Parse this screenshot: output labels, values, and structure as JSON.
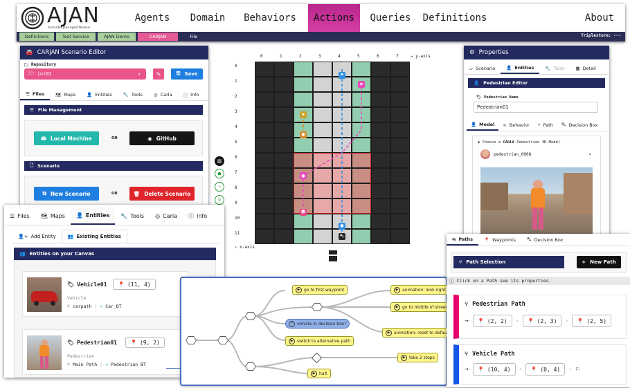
{
  "app": {
    "logo_text": "AJAN",
    "logo_subtitle": "Accessible Java Agent Nucleus",
    "nav": [
      "Agents",
      "Domain",
      "Behaviors",
      "Actions",
      "Queries",
      "Definitions"
    ],
    "nav_about": "About",
    "subnav": [
      "Definitions",
      "Test Service",
      "AJAN Demo",
      "CARJAN",
      "File"
    ],
    "triplestore": "Triplestore: ---",
    "colors": {
      "nav_bg": "#ffffff",
      "active_nav": "#c8359c",
      "subnav_bg": "#2a2d55",
      "navy": "#232a60",
      "pink": "#e9558a"
    }
  },
  "editor": {
    "title": "CARJAN Scenario Editor",
    "repo_label": "Repository",
    "repo_value": "int01",
    "save_label": "Save",
    "tabs": [
      "Files",
      "Maps",
      "Entities",
      "Tools",
      "Carla",
      "Info"
    ],
    "file_management": "File Management",
    "local_machine": "Local Machine",
    "or1": "OR",
    "github": "GitHub",
    "scenario_header": "Scenario",
    "new_scenario": "New Scenario",
    "or2": "OR",
    "delete_scenario": "Delete Scenario"
  },
  "grid": {
    "col_labels": [
      "0",
      "1",
      "2",
      "3",
      "4",
      "5",
      "6",
      "7"
    ],
    "row_labels": [
      "0",
      "1",
      "2",
      "3",
      "4",
      "5",
      "6",
      "7",
      "8",
      "9",
      "10",
      "11"
    ],
    "y_axis": "→ y-axis",
    "x_axis": "↓ x-axis",
    "col_types": [
      "dark",
      "dark",
      "green",
      "grey",
      "grey",
      "green",
      "dark",
      "dark"
    ],
    "decision_box": {
      "rows": [
        6,
        9
      ],
      "cols": [
        2,
        5
      ]
    }
  },
  "properties": {
    "title": "Properties",
    "tabs": [
      "Scenario",
      "Entities",
      "Tools",
      "Detail"
    ],
    "pedestrian_editor": "Pedestrian Editor",
    "name_label": "Pedestrian Name",
    "name_value": "Pedestrian01",
    "subtabs": [
      "Model",
      "Behavior",
      "Path",
      "Decision Box"
    ],
    "choose_prefix": "Choose a ",
    "choose_bold": "CARLA",
    "choose_suffix": " Pedestrian 3D-Model",
    "model_value": "pedestrian_0008"
  },
  "entities": {
    "tabs": [
      "Files",
      "Maps",
      "Entities",
      "Tools",
      "Carla",
      "Info"
    ],
    "subtabs": [
      "Add Entity",
      "Existing Entities"
    ],
    "header": "Entities on your Canvas",
    "items": [
      {
        "name": "Vehicle01",
        "pos": "(11, 4)",
        "type": "Vehicle",
        "path": "carpath",
        "behavior": "Car_BT"
      },
      {
        "name": "Pedestrian01",
        "pos": "(9, 2)",
        "type": "Pedestrian",
        "path": "Main Path",
        "behavior": "Pedestrian BT"
      }
    ]
  },
  "tree": {
    "nodes": {
      "n1": "go to first waypoint",
      "n2": "animation: look right",
      "n3": "go to middle of street",
      "n4": "vehicle in decision box?",
      "n5": "animation: reset to default",
      "n6": "switch to alternative path",
      "n7": "take 2 steps",
      "n8": "halt"
    }
  },
  "paths": {
    "tabs": [
      "Paths",
      "Waypoints",
      "Decision Box"
    ],
    "selection": "Path Selection",
    "new_path": "New Path",
    "hint": "Click on a Path see its properties.",
    "items": [
      {
        "name": "Pedestrian Path",
        "waypoints": [
          "(2, 2)",
          "(2, 3)",
          "(2, 5)"
        ],
        "color": "#e4006b"
      },
      {
        "name": "Vehicle Path",
        "waypoints": [
          "(10, 4)",
          "(0, 4)"
        ],
        "color": "#1356e8"
      }
    ]
  }
}
